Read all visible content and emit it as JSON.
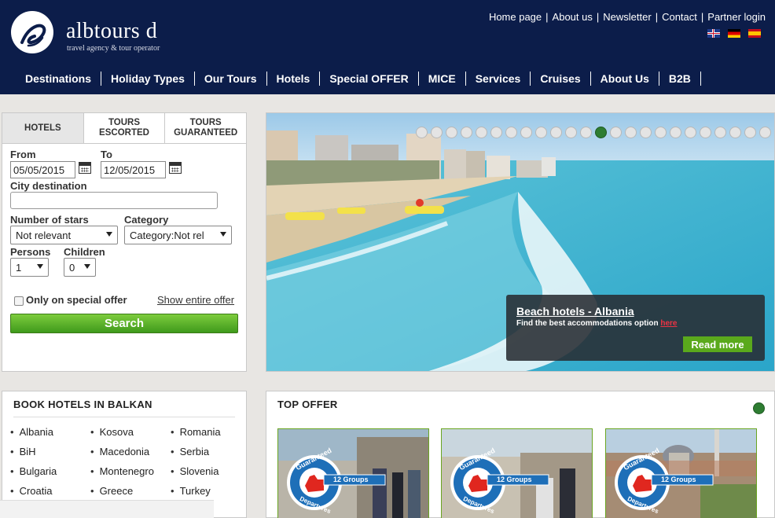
{
  "brand": {
    "name": "albtours d",
    "tagline": "travel agency & tour operator"
  },
  "top_links": [
    "Home page",
    "About us",
    "Newsletter",
    "Contact",
    "Partner login"
  ],
  "flags": [
    "uk-flag-icon",
    "germany-flag-icon",
    "spain-flag-icon"
  ],
  "nav": [
    "Destinations",
    "Holiday Types",
    "Our Tours",
    "Hotels",
    "Special OFFER",
    "MICE",
    "Services",
    "Cruises",
    "About Us",
    "B2B"
  ],
  "search": {
    "tabs": [
      "HOTELS",
      "TOURS ESCORTED",
      "TOURS GUARANTEED"
    ],
    "from_label": "From",
    "from_value": "05/05/2015",
    "to_label": "To",
    "to_value": "12/05/2015",
    "city_label": "City destination",
    "city_value": "",
    "stars_label": "Number of stars",
    "stars_value": "Not relevant",
    "category_label": "Category",
    "category_value": "Category:Not rel",
    "persons_label": "Persons",
    "persons_value": "1",
    "children_label": "Children",
    "children_value": "0",
    "special_offer_label": "Only on special offer",
    "show_offer_link": "Show entire offer",
    "search_button": "Search"
  },
  "slider": {
    "dot_count": 24,
    "active_dot_index": 12,
    "caption_title": "Beach hotels - Albania",
    "caption_text": "Find the best accommodations option",
    "caption_link": "here",
    "read_more": "Read more"
  },
  "balkan": {
    "title": "BOOK HOTELS IN BALKAN",
    "countries": [
      "Albania",
      "Kosova",
      "Romania",
      "BiH",
      "Macedonia",
      "Serbia",
      "Bulgaria",
      "Montenegro",
      "Slovenia",
      "Croatia",
      "Greece",
      "Turkey"
    ]
  },
  "top_offer": {
    "title": "TOP OFFER",
    "badge_top": "Guaranteed",
    "badge_groups": "12 Groups",
    "badge_bottom": "Departures",
    "colors": {
      "accent_green": "#5aa91c",
      "navy": "#0c1d4a",
      "badge_blue": "#1e6fb8",
      "badge_red": "#e0271f"
    }
  }
}
